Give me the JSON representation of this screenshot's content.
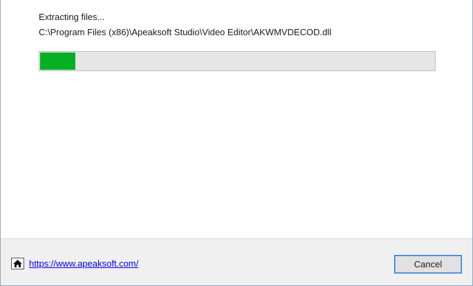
{
  "installer": {
    "status_text": "Extracting files...",
    "current_file": "C:\\Program Files (x86)\\Apeaksoft Studio\\Video Editor\\AKWMVDECOD.dll",
    "progress_fraction": 0.09,
    "progress_color": "#06b025"
  },
  "footer": {
    "home_icon": "home-icon",
    "link_text": "https://www.apeaksoft.com/",
    "cancel_label": "Cancel"
  }
}
